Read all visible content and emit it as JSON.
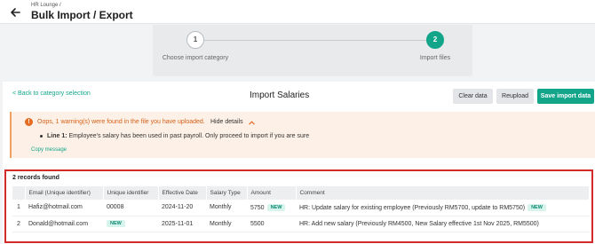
{
  "header": {
    "breadcrumb": "HR Lounge /",
    "title": "Bulk Import / Export"
  },
  "steps": [
    {
      "number": "1",
      "label": "Choose import category",
      "state": "done"
    },
    {
      "number": "2",
      "label": "Import files",
      "state": "active"
    }
  ],
  "main": {
    "back_link": "< Back to category selection",
    "title": "Import Salaries",
    "buttons": {
      "clear": "Clear data",
      "reupload": "Reupload",
      "save": "Save import data"
    }
  },
  "warning": {
    "icon": "!",
    "title": "Oops, 1 warning(s) were found in the file you have uploaded.",
    "hide_details": "Hide details",
    "line_label": "Line 1:",
    "line_text": " Employee's salary has been used in past payroll. Only proceed to import if you are sure",
    "copy_message": "Copy message"
  },
  "records": {
    "count_label": "2 records found",
    "columns": [
      "",
      "Email (Unique identifier)",
      "Unique identifier",
      "Effective Date",
      "Salary Type",
      "Amount",
      "Comment"
    ],
    "new_badge": "NEW",
    "rows": [
      {
        "index": "1",
        "email": "Hafiz@hotmail.com",
        "unique_id": "00008",
        "effective_date": "2024-11-20",
        "salary_type": "Monthly",
        "amount": "5750",
        "comment": "HR: Update salary for existing employee (Previously RM5700, update to RM5750)"
      },
      {
        "index": "2",
        "email": "Donald@hotmail.com",
        "unique_id": "",
        "effective_date": "2025-11-01",
        "salary_type": "Monthly",
        "amount": "5500",
        "comment": "HR: Add new salary (Previously RM4500, New Salary effective 1st Nov 2025, RM5500)"
      }
    ]
  },
  "colors": {
    "accent": "#12a58a",
    "warning": "#e46b1f",
    "highlight_border": "#d32a2a"
  }
}
